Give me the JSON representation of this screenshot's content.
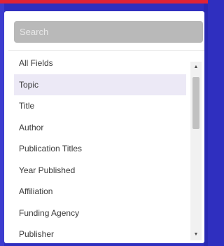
{
  "search": {
    "placeholder": "Search",
    "value": ""
  },
  "list": {
    "items": [
      {
        "label": "All Fields",
        "selected": false
      },
      {
        "label": "Topic",
        "selected": true
      },
      {
        "label": "Title",
        "selected": false
      },
      {
        "label": "Author",
        "selected": false
      },
      {
        "label": "Publication Titles",
        "selected": false
      },
      {
        "label": "Year Published",
        "selected": false
      },
      {
        "label": "Affiliation",
        "selected": false
      },
      {
        "label": "Funding Agency",
        "selected": false
      },
      {
        "label": "Publisher",
        "selected": false
      }
    ]
  },
  "scrollbar": {
    "up_icon": "arrow-up-icon",
    "down_icon": "arrow-down-icon"
  },
  "colors": {
    "selected_bg": "#ece9f6",
    "search_bg": "#b9b9b9",
    "backdrop": "#2f2fbf",
    "accent_strip": "#e02335"
  }
}
